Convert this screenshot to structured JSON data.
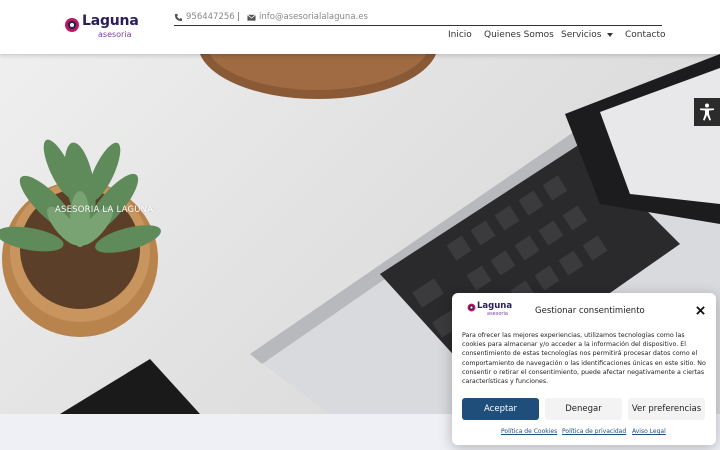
{
  "brand": {
    "name": "Laguna",
    "sub": "asesoria"
  },
  "contact": {
    "phone": "956447256",
    "separator": "|",
    "email": "info@asesorialalaguna.es"
  },
  "nav": {
    "items": [
      "Inicio",
      "Quienes Somos",
      "Servicios",
      "Contacto"
    ]
  },
  "hero": {
    "title": "ASESORIA LA LAGUNA"
  },
  "consent": {
    "title": "Gestionar consentimiento",
    "body": "Para ofrecer las mejores experiencias, utilizamos tecnologías como las cookies para almacenar y/o acceder a la información del dispositivo. El consentimiento de estas tecnologías nos permitirá procesar datos como el comportamiento de navegación o las identificaciones únicas en este sitio. No consentir o retirar el consentimiento, puede afectar negativamente a ciertas características y funciones.",
    "accept": "Aceptar",
    "deny": "Denegar",
    "preferences": "Ver preferencias",
    "links": [
      "Política de Cookies",
      "Política de privacidad",
      "Aviso Legal"
    ]
  },
  "colors": {
    "brand_navy": "#2a1d5c",
    "brand_purple": "#7a3fa0",
    "accent_red": "#c2185b",
    "button_blue": "#1e4e79"
  },
  "icons": [
    "phone-icon",
    "envelope-icon",
    "caret-down-icon",
    "accessibility-icon",
    "close-icon"
  ]
}
